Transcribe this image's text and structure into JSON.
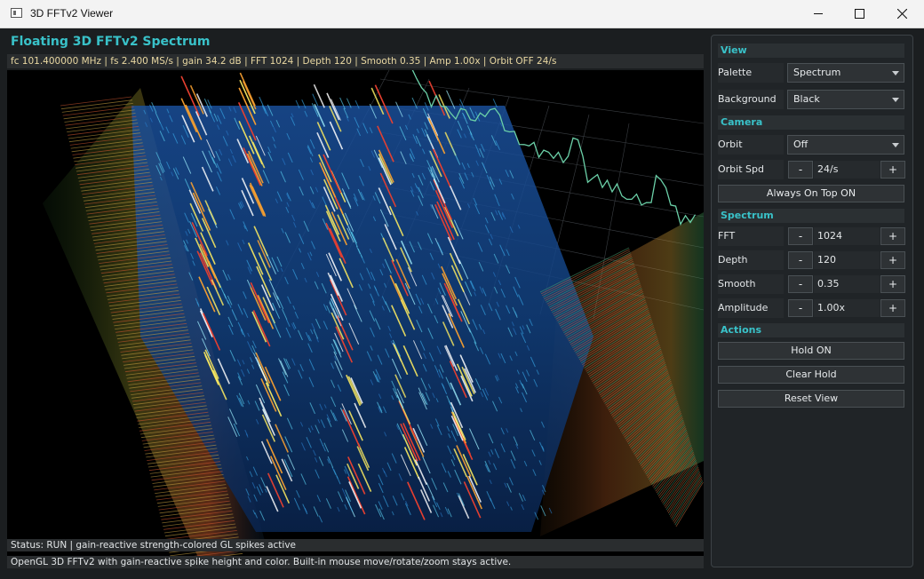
{
  "window": {
    "title": "3D FFTv2 Viewer"
  },
  "header": {
    "title": "Floating 3D FFTv2 Spectrum",
    "info": "fc 101.400000 MHz | fs 2.400 MS/s | gain 34.2 dB | FFT 1024 | Depth 120 | Smooth 0.35 | Amp 1.00x | Orbit OFF 24/s"
  },
  "status": {
    "line1": "Status: RUN | gain-reactive strength-colored GL spikes active",
    "line2": "OpenGL 3D FFTv2 with gain-reactive spike height and color. Built-in mouse move/rotate/zoom stays active."
  },
  "panel": {
    "view": {
      "title": "View",
      "palette_label": "Palette",
      "palette_value": "Spectrum",
      "background_label": "Background",
      "background_value": "Black"
    },
    "camera": {
      "title": "Camera",
      "orbit_label": "Orbit",
      "orbit_value": "Off",
      "orbit_speed_label": "Orbit Spd",
      "orbit_speed_value": "24/s",
      "always_on_top": "Always On Top ON"
    },
    "spectrum": {
      "title": "Spectrum",
      "fft_label": "FFT",
      "fft_value": "1024",
      "depth_label": "Depth",
      "depth_value": "120",
      "smooth_label": "Smooth",
      "smooth_value": "0.35",
      "amplitude_label": "Amplitude",
      "amplitude_value": "1.00x"
    },
    "actions": {
      "title": "Actions",
      "hold": "Hold ON",
      "clear_hold": "Clear Hold",
      "reset_view": "Reset View"
    },
    "minus": "-",
    "plus": "+"
  },
  "colors": {
    "accent": "#39c2c9",
    "info_text": "#e9d8a2",
    "panel_bg": "#202427"
  },
  "icons": [
    "app-icon",
    "minimize-icon",
    "maximize-icon",
    "close-icon",
    "dropdown-arrow-icon"
  ]
}
